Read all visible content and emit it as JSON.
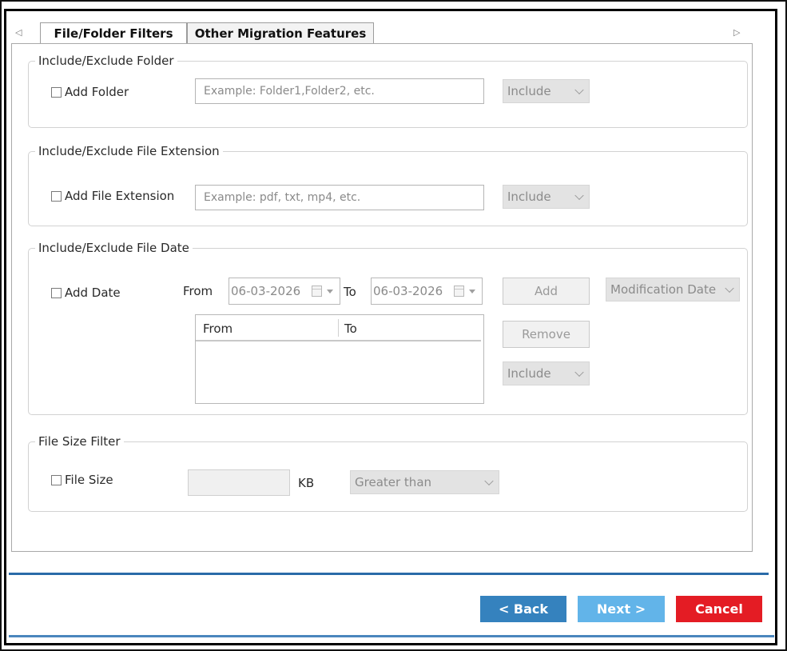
{
  "tabs": {
    "items": [
      {
        "label": "File/Folder Filters",
        "active": true
      },
      {
        "label": "Other Migration Features",
        "active": false
      }
    ],
    "left_arrow": "◁",
    "right_arrow": "▷"
  },
  "folder_group": {
    "legend": "Include/Exclude Folder",
    "checkbox_label": "Add Folder",
    "input_placeholder": "Example: Folder1,Folder2, etc.",
    "mode_value": "Include"
  },
  "extension_group": {
    "legend": "Include/Exclude File Extension",
    "checkbox_label": "Add File Extension",
    "input_placeholder": "Example: pdf, txt, mp4, etc.",
    "mode_value": "Include"
  },
  "date_group": {
    "legend": "Include/Exclude File Date",
    "checkbox_label": "Add Date",
    "from_label": "From",
    "from_value": "06-03-2026",
    "to_label": "To",
    "to_value": "06-03-2026",
    "add_button": "Add",
    "remove_button": "Remove",
    "date_type_value": "Modification Date",
    "mode_value": "Include",
    "table_columns": [
      "From",
      "To"
    ]
  },
  "size_group": {
    "legend": "File Size Filter",
    "checkbox_label": "File Size",
    "size_value": "",
    "unit_label": "KB",
    "comparison_value": "Greater than"
  },
  "footer": {
    "back_label": "< Back",
    "next_label": "Next >",
    "cancel_label": "Cancel"
  },
  "colors": {
    "back_button": "#3582be",
    "next_button": "#62b4e9",
    "cancel_button": "#e41c24",
    "separator": "#2a6ba8"
  }
}
